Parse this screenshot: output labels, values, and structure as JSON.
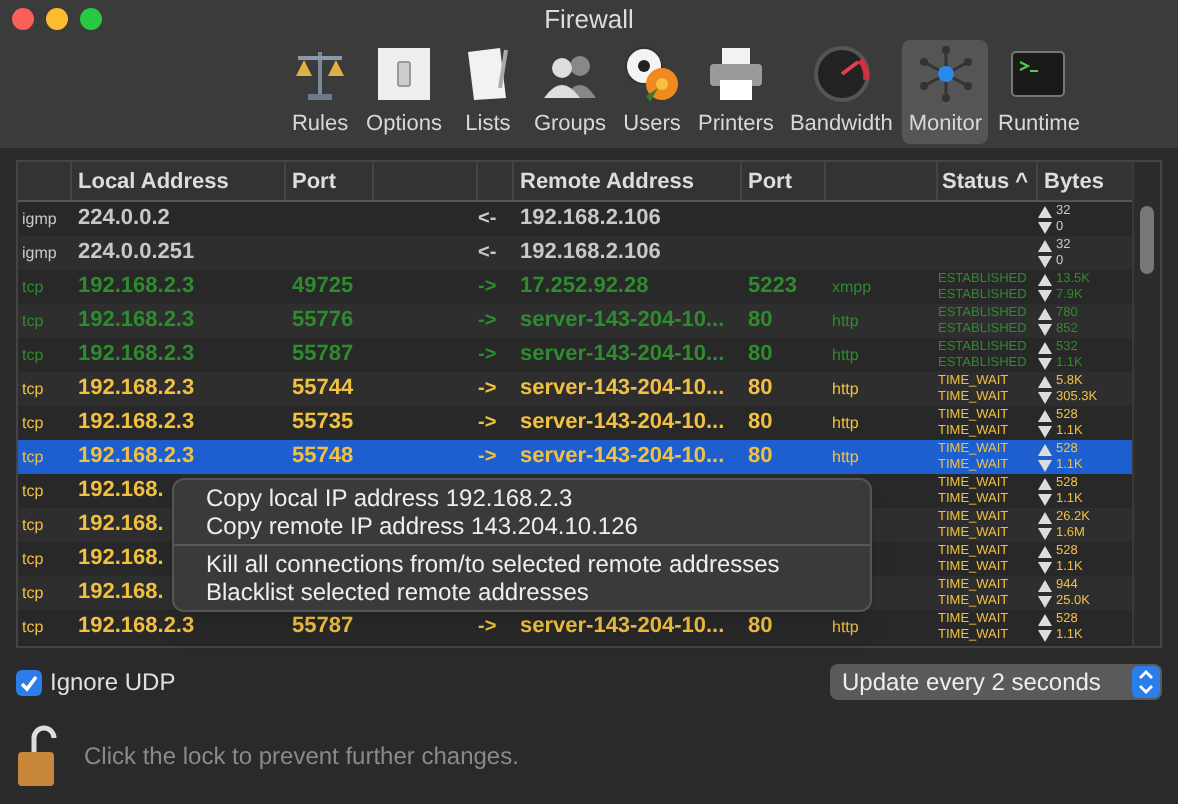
{
  "window": {
    "title": "Firewall"
  },
  "toolbar": [
    {
      "label": "Rules",
      "kind": "scale",
      "selected": false
    },
    {
      "label": "Options",
      "kind": "switch",
      "selected": false
    },
    {
      "label": "Lists",
      "kind": "document",
      "selected": false
    },
    {
      "label": "Groups",
      "kind": "people",
      "selected": false
    },
    {
      "label": "Users",
      "kind": "ball",
      "selected": false
    },
    {
      "label": "Printers",
      "kind": "printer",
      "selected": false
    },
    {
      "label": "Bandwidth",
      "kind": "gauge",
      "selected": false
    },
    {
      "label": "Monitor",
      "kind": "network",
      "selected": true
    },
    {
      "label": "Runtime",
      "kind": "terminal",
      "selected": false
    }
  ],
  "table": {
    "columns": [
      "Local Address",
      "Port",
      "Remote Address",
      "Port",
      "Status ^",
      "Bytes"
    ],
    "rows": [
      {
        "protocol": "igmp",
        "local_address": "224.0.0.2",
        "direction": "<-",
        "remote_address": "192.168.2.106",
        "bytes_up": "32",
        "bytes_down": "0",
        "color": "#c8c8c8",
        "selected": false
      },
      {
        "protocol": "igmp",
        "local_address": "224.0.0.251",
        "direction": "<-",
        "remote_address": "192.168.2.106",
        "bytes_up": "32",
        "bytes_down": "0",
        "color": "#c8c8c8",
        "selected": false
      },
      {
        "protocol": "tcp",
        "local_address": "192.168.2.3",
        "local_port": "49725",
        "direction": "->",
        "remote_address": "17.252.92.28",
        "remote_port": "5223",
        "service": "xmpp",
        "status_1": "ESTABLISHED",
        "status_2": "ESTABLISHED",
        "bytes_up": "13.5K",
        "bytes_down": "7.9K",
        "color": "#2e8b2e",
        "selected": false
      },
      {
        "protocol": "tcp",
        "local_address": "192.168.2.3",
        "local_port": "55776",
        "direction": "->",
        "remote_address": "server-143-204-10...",
        "remote_port": "80",
        "service": "http",
        "status_1": "ESTABLISHED",
        "status_2": "ESTABLISHED",
        "bytes_up": "780",
        "bytes_down": "852",
        "color": "#2e8b2e",
        "selected": false
      },
      {
        "protocol": "tcp",
        "local_address": "192.168.2.3",
        "local_port": "55787",
        "direction": "->",
        "remote_address": "server-143-204-10...",
        "remote_port": "80",
        "service": "http",
        "status_1": "ESTABLISHED",
        "status_2": "ESTABLISHED",
        "bytes_up": "532",
        "bytes_down": "1.1K",
        "color": "#2e8b2e",
        "selected": false
      },
      {
        "protocol": "tcp",
        "local_address": "192.168.2.3",
        "local_port": "55744",
        "direction": "->",
        "remote_address": "server-143-204-10...",
        "remote_port": "80",
        "service": "http",
        "status_1": "TIME_WAIT",
        "status_2": "TIME_WAIT",
        "bytes_up": "5.8K",
        "bytes_down": "305.3K",
        "color": "#f2c040",
        "selected": false
      },
      {
        "protocol": "tcp",
        "local_address": "192.168.2.3",
        "local_port": "55735",
        "direction": "->",
        "remote_address": "server-143-204-10...",
        "remote_port": "80",
        "service": "http",
        "status_1": "TIME_WAIT",
        "status_2": "TIME_WAIT",
        "bytes_up": "528",
        "bytes_down": "1.1K",
        "color": "#f2c040",
        "selected": false
      },
      {
        "protocol": "tcp",
        "local_address": "192.168.2.3",
        "local_port": "55748",
        "direction": "->",
        "remote_address": "server-143-204-10...",
        "remote_port": "80",
        "service": "http",
        "status_1": "TIME_WAIT",
        "status_2": "TIME_WAIT",
        "bytes_up": "528",
        "bytes_down": "1.1K",
        "color": "#f2c040",
        "selected": true
      },
      {
        "protocol": "tcp",
        "local_address": "192.168.",
        "status_1": "TIME_WAIT",
        "status_2": "TIME_WAIT",
        "bytes_up": "528",
        "bytes_down": "1.1K",
        "color": "#f2c040",
        "selected": false
      },
      {
        "protocol": "tcp",
        "local_address": "192.168.",
        "status_1": "TIME_WAIT",
        "status_2": "TIME_WAIT",
        "bytes_up": "26.2K",
        "bytes_down": "1.6M",
        "color": "#f2c040",
        "selected": false
      },
      {
        "protocol": "tcp",
        "local_address": "192.168.",
        "status_1": "TIME_WAIT",
        "status_2": "TIME_WAIT",
        "bytes_up": "528",
        "bytes_down": "1.1K",
        "color": "#f2c040",
        "selected": false
      },
      {
        "protocol": "tcp",
        "local_address": "192.168.",
        "status_1": "TIME_WAIT",
        "status_2": "TIME_WAIT",
        "bytes_up": "944",
        "bytes_down": "25.0K",
        "color": "#f2c040",
        "selected": false
      },
      {
        "protocol": "tcp",
        "local_address": "192.168.2.3",
        "local_port": "55787",
        "direction": "->",
        "remote_address": "server-143-204-10...",
        "remote_port": "80",
        "service": "http",
        "status_1": "TIME_WAIT",
        "status_2": "TIME_WAIT",
        "bytes_up": "528",
        "bytes_down": "1.1K",
        "color": "#f2c040",
        "selected": false
      }
    ]
  },
  "context_menu": {
    "groups": [
      [
        "Copy local IP address 192.168.2.3",
        "Copy remote IP address 143.204.10.126"
      ],
      [
        "Kill all connections from/to selected remote addresses",
        "Blacklist selected remote addresses"
      ]
    ]
  },
  "ignore_udp": {
    "label": "Ignore UDP",
    "checked": true
  },
  "update_popup": {
    "value": "Update every 2 seconds"
  },
  "lock": {
    "text": "Click the lock to prevent further changes."
  }
}
